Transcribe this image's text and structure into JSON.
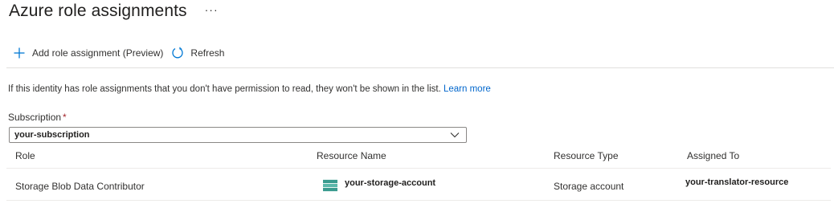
{
  "header": {
    "title": "Azure role assignments",
    "more_label": "···"
  },
  "toolbar": {
    "add_label": "Add role assignment (Preview)",
    "add_icon": "plus-icon",
    "refresh_label": "Refresh",
    "refresh_icon": "refresh-icon"
  },
  "info": {
    "text": "If this identity has role assignments that you don't have permission to read, they won't be shown in the list.",
    "link": "Learn more"
  },
  "subscription": {
    "label": "Subscription",
    "required_marker": "*",
    "selected": "your-subscription"
  },
  "table": {
    "headers": [
      "Role",
      "Resource Name",
      "Resource Type",
      "Assigned To"
    ],
    "rows": [
      {
        "role": "Storage Blob Data Contributor",
        "resource_name": "your-storage-account",
        "resource_icon": "storage-account-icon",
        "resource_type": "Storage account",
        "assigned_to": "your-translator-resource"
      }
    ]
  },
  "colors": {
    "link": "#0066cc",
    "accent": "#0078d4",
    "required": "#a4262c",
    "storage_icon": "#3a9b8f"
  }
}
